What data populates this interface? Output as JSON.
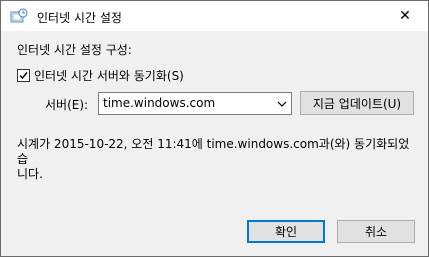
{
  "window": {
    "title": "인터넷 시간 설정",
    "close_glyph": "✕"
  },
  "config_label": "인터넷 시간 설정 구성:",
  "sync_checkbox": {
    "label": "인터넷 시간 서버와 동기화(S)",
    "checked": true
  },
  "server": {
    "label": "서버(E):",
    "value": "time.windows.com"
  },
  "update_button": "지금 업데이트(U)",
  "status_line1": "시계가 2015-10-22, 오전 11:41에 time.windows.com과(와) 동기화되었습",
  "status_line2": "니다.",
  "ok_button": "확인",
  "cancel_button": "취소",
  "colors": {
    "accent": "#0078d7",
    "dialog_bg": "#f0f0f0",
    "button_bg": "#e1e1e1"
  }
}
